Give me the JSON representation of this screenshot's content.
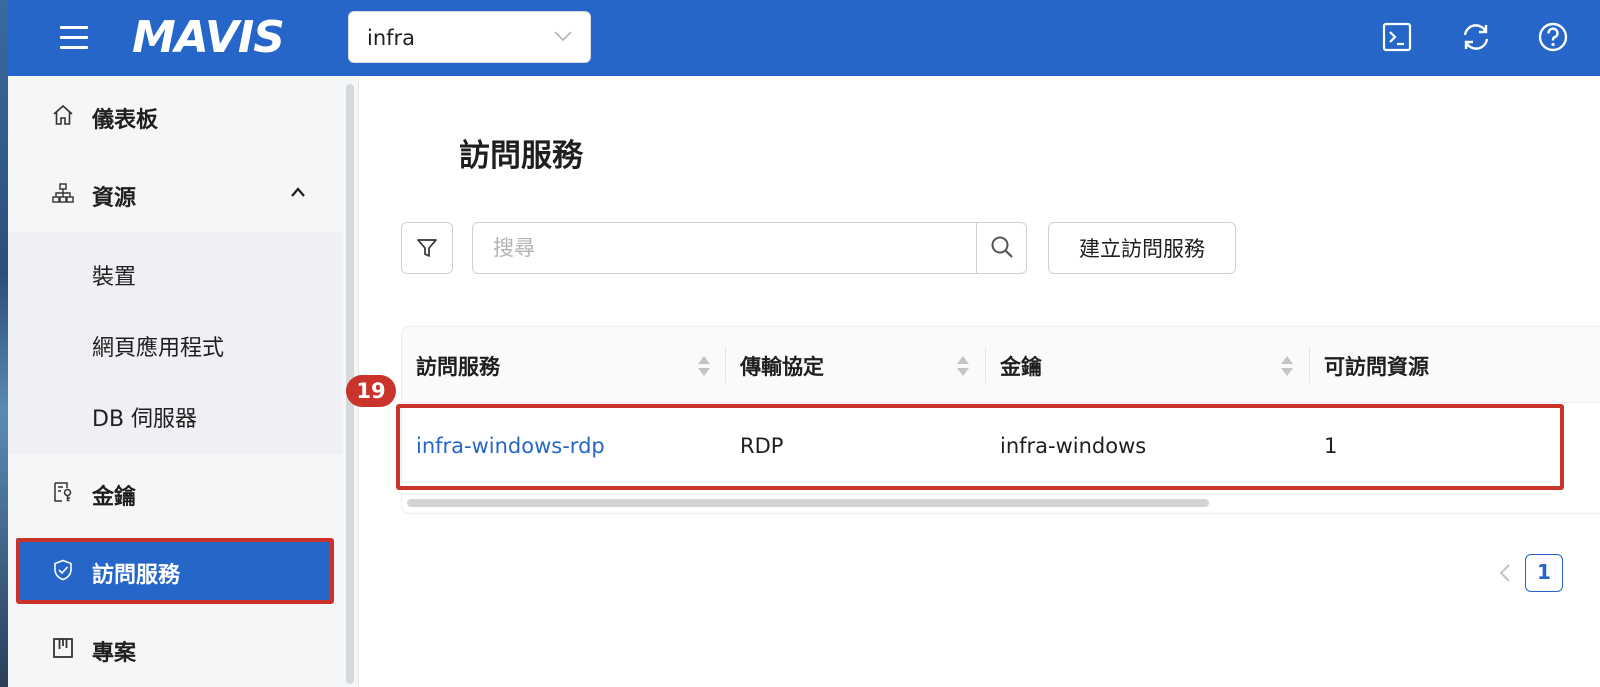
{
  "header": {
    "logo": "MAVIS",
    "project_select": {
      "value": "infra"
    },
    "icons": [
      "terminal-icon",
      "refresh-icon",
      "help-icon"
    ]
  },
  "sidebar": {
    "items": [
      {
        "label": "儀表板",
        "icon": "home-icon"
      },
      {
        "label": "資源",
        "icon": "sitemap-icon",
        "expanded": true,
        "children": [
          {
            "label": "裝置"
          },
          {
            "label": "網頁應用程式"
          },
          {
            "label": "DB 伺服器"
          }
        ]
      },
      {
        "label": "金鑰",
        "icon": "key-card-icon"
      },
      {
        "label": "訪問服務",
        "icon": "shield-check-icon",
        "active": true
      },
      {
        "label": "專案",
        "icon": "project-board-icon"
      }
    ]
  },
  "main": {
    "title": "訪問服務",
    "search_placeholder": "搜尋",
    "create_button": "建立訪問服務",
    "table": {
      "columns": [
        "訪問服務",
        "傳輸協定",
        "金鑰",
        "可訪問資源"
      ],
      "rows": [
        {
          "name": "infra-windows-rdp",
          "protocol": "RDP",
          "key": "infra-windows",
          "resources": "1"
        }
      ]
    },
    "step_badge": "19",
    "pagination": {
      "current": "1"
    }
  },
  "colors": {
    "brand": "#2566c8",
    "annotation": "#c9332a"
  }
}
